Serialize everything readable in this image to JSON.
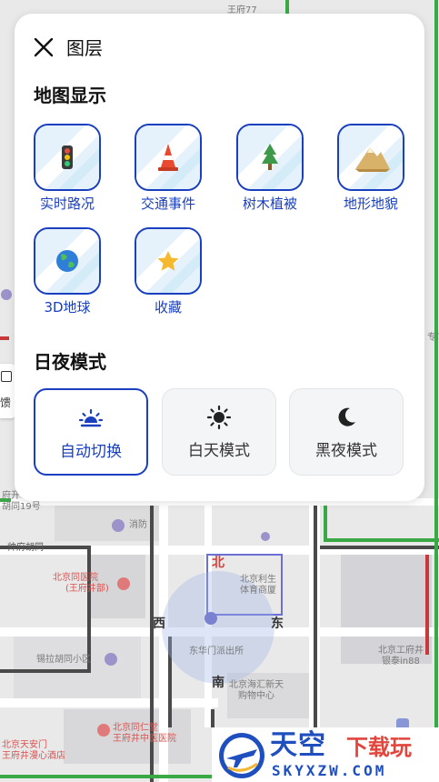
{
  "panel": {
    "title": "图层",
    "map_display": {
      "heading": "地图显示",
      "items": [
        {
          "label": "实时路况",
          "icon": "traffic-light-icon"
        },
        {
          "label": "交通事件",
          "icon": "traffic-cone-icon"
        },
        {
          "label": "树木植被",
          "icon": "tree-icon"
        },
        {
          "label": "地形地貌",
          "icon": "mountain-icon"
        },
        {
          "label": "3D地球",
          "icon": "globe-icon"
        },
        {
          "label": "收藏",
          "icon": "star-icon"
        }
      ]
    },
    "day_night": {
      "heading": "日夜模式",
      "modes": [
        {
          "label": "自动切换",
          "icon": "sunrise-icon",
          "selected": true
        },
        {
          "label": "白天模式",
          "icon": "sun-icon",
          "selected": false
        },
        {
          "label": "黑夜模式",
          "icon": "moon-icon",
          "selected": false
        }
      ]
    }
  },
  "edge_widget": {
    "text": "馈"
  },
  "map": {
    "labels": {
      "top_road": "王府77",
      "fu_kai": "府开",
      "hutong19": "胡同19号",
      "fire_station": "消防",
      "shuaifu": "帅府胡同",
      "hospital": "北京同医院",
      "hospital_sub": "(王府井部)",
      "west": "西",
      "north": "北",
      "east": "东",
      "south": "南",
      "stadium1": "北京利生",
      "stadium2": "体育商厦",
      "xiaoqu": "锡拉胡同小区",
      "police": "东华门派出所",
      "tongrentang1": "北京同仁堂",
      "tongrentang2": "王府井中医医院",
      "mall1": "北京海汇新天",
      "mall2": "购物中心",
      "wfj1": "北京工府井",
      "wfj2": "银泰in88",
      "hotel1": "北京天安门",
      "hotel2": "王府井漫心酒店",
      "right_store": "专店"
    }
  },
  "watermark": {
    "cn_main": "天空",
    "cn_sub": "下载玩",
    "en": "SKYXZW.COM"
  },
  "colors": {
    "accent": "#1a3fbf",
    "road_green": "#3aa845",
    "north_red": "#d9403a"
  }
}
